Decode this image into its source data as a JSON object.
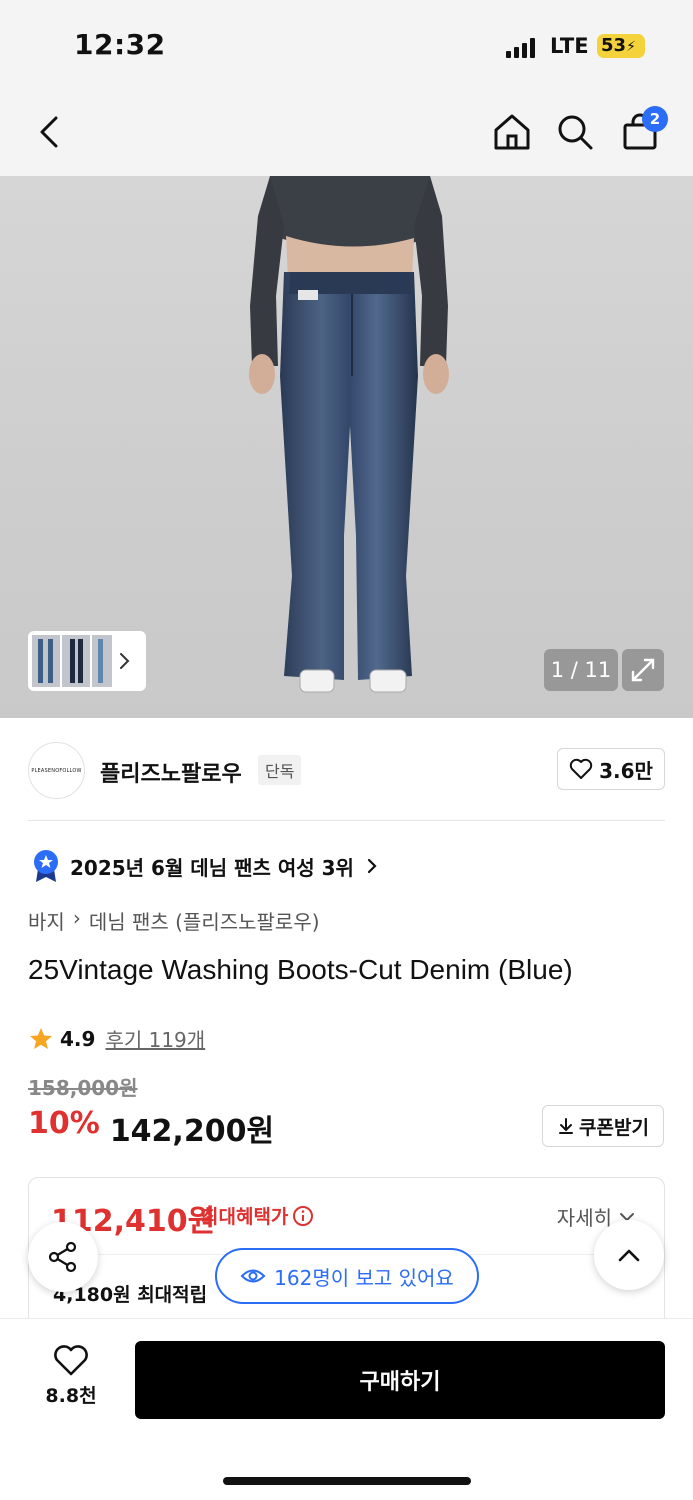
{
  "status_bar": {
    "time": "12:32",
    "network": "LTE",
    "battery": "53"
  },
  "nav": {
    "cart_count": "2"
  },
  "gallery": {
    "counter": "1 / 11"
  },
  "brand": {
    "logo_text": "PLEASENOFOLLOW",
    "name": "플리즈노팔로우",
    "tag": "단독",
    "likes": "3.6만"
  },
  "ranking": {
    "text": "2025년 6월 데님 팬츠 여성 3위"
  },
  "breadcrumb": {
    "category": "바지",
    "subcategory": "데님 팬츠 (플리즈노팔로우)"
  },
  "product": {
    "title": "25Vintage Washing Boots-Cut Denim (Blue)",
    "rating": "4.9",
    "reviews": "후기 119개",
    "original_price": "158,000원",
    "discount": "10%",
    "sale_price": "142,200원",
    "coupon_label": "쿠폰받기"
  },
  "benefit": {
    "max_price": "112,410원",
    "max_label": "최대혜택가",
    "detail_label": "자세히",
    "points": "4,180원 최대적립"
  },
  "viewers": {
    "text": "162명이 보고 있어요"
  },
  "bottom": {
    "wish_count": "8.8천",
    "buy_label": "구매하기"
  },
  "colors": {
    "accent_blue": "#2b6df6",
    "sale_red": "#e03131",
    "buy_black": "#000000"
  }
}
